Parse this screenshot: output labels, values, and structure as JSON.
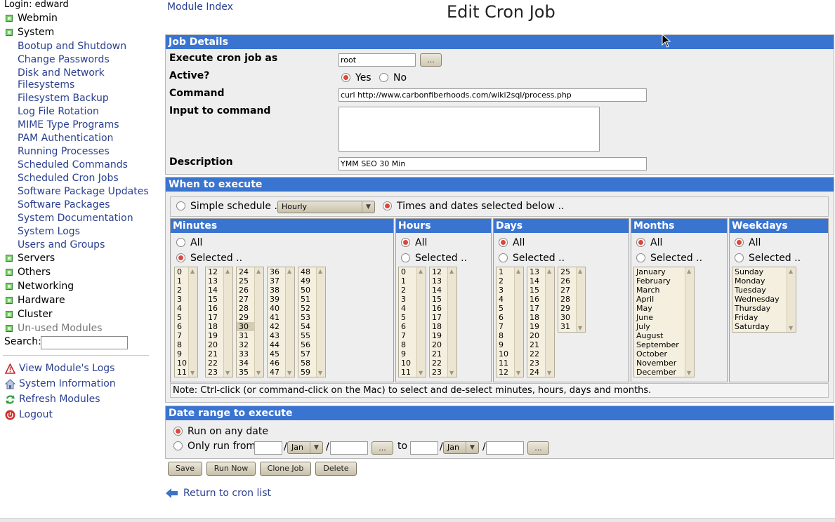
{
  "left": {
    "login": "Login: edward",
    "categories": {
      "webmin": "Webmin",
      "system": "System",
      "servers": "Servers",
      "others": "Others",
      "networking": "Networking",
      "hardware": "Hardware",
      "cluster": "Cluster",
      "unused": "Un-used Modules"
    },
    "system_items": [
      "Bootup and Shutdown",
      "Change Passwords",
      "Disk and Network",
      "Filesystems",
      "Filesystem Backup",
      "Log File Rotation",
      "MIME Type Programs",
      "PAM Authentication",
      "Running Processes",
      "Scheduled Commands",
      "Scheduled Cron Jobs",
      "Software Package Updates",
      "Software Packages",
      "System Documentation",
      "System Logs",
      "Users and Groups"
    ],
    "search_label": "Search:",
    "actions": {
      "view_logs": "View Module's Logs",
      "system_info": "System Information",
      "refresh": "Refresh Modules",
      "logout": "Logout"
    }
  },
  "header": {
    "module_index": "Module Index",
    "title": "Edit Cron Job"
  },
  "job_details": {
    "header": "Job Details",
    "execute_as_label": "Execute cron job as",
    "execute_as_value": "root",
    "user_picker_button": "...",
    "active_label": "Active?",
    "active_yes": "Yes",
    "active_no": "No",
    "command_label": "Command",
    "command_value": "curl http://www.carbonfiberhoods.com/wiki2sql/process.php",
    "input_label": "Input to command",
    "description_label": "Description",
    "description_value": "YMM SEO 30 Min"
  },
  "when": {
    "header": "When to execute",
    "simple_label": "Simple schedule ..",
    "simple_value": "Hourly",
    "selected_label": "Times and dates selected below ..",
    "all_label": "All",
    "selected_option_label": "Selected ..",
    "minutes_header": "Minutes",
    "hours_header": "Hours",
    "days_header": "Days",
    "months_header": "Months",
    "weekdays_header": "Weekdays",
    "minutes_cols": [
      [
        "0",
        "1",
        "2",
        "3",
        "4",
        "5",
        "6",
        "7",
        "8",
        "9",
        "10",
        "11"
      ],
      [
        "12",
        "13",
        "14",
        "15",
        "16",
        "17",
        "18",
        "19",
        "20",
        "21",
        "22",
        "23"
      ],
      [
        "24",
        "25",
        "26",
        "27",
        "28",
        "29",
        "30",
        "31",
        "32",
        "33",
        "34",
        "35"
      ],
      [
        "36",
        "37",
        "38",
        "39",
        "40",
        "41",
        "42",
        "43",
        "44",
        "45",
        "46",
        "47"
      ],
      [
        "48",
        "49",
        "50",
        "51",
        "52",
        "53",
        "54",
        "55",
        "56",
        "57",
        "58",
        "59"
      ]
    ],
    "minutes_selected": "30",
    "hours_cols": [
      [
        "0",
        "1",
        "2",
        "3",
        "4",
        "5",
        "6",
        "7",
        "8",
        "9",
        "10",
        "11"
      ],
      [
        "12",
        "13",
        "14",
        "15",
        "16",
        "17",
        "18",
        "19",
        "20",
        "21",
        "22",
        "23"
      ]
    ],
    "days_cols": [
      [
        "1",
        "2",
        "3",
        "4",
        "5",
        "6",
        "7",
        "8",
        "9",
        "10",
        "11",
        "12"
      ],
      [
        "13",
        "14",
        "15",
        "16",
        "17",
        "18",
        "19",
        "20",
        "21",
        "22",
        "23",
        "24"
      ],
      [
        "25",
        "26",
        "27",
        "28",
        "29",
        "30",
        "31"
      ]
    ],
    "months": [
      "January",
      "February",
      "March",
      "April",
      "May",
      "June",
      "July",
      "August",
      "September",
      "October",
      "November",
      "December"
    ],
    "weekdays": [
      "Sunday",
      "Monday",
      "Tuesday",
      "Wednesday",
      "Thursday",
      "Friday",
      "Saturday"
    ],
    "note": "Note: Ctrl-click (or command-click on the Mac) to select and de-select minutes, hours, days and months."
  },
  "date_range": {
    "header": "Date range to execute",
    "any_date": "Run on any date",
    "only_from": "Only run from",
    "month_from": "Jan",
    "month_to": "Jan",
    "to_label": "to",
    "picker_button": "...",
    "slash": "/"
  },
  "buttons": {
    "save": "Save",
    "run_now": "Run Now",
    "clone": "Clone Job",
    "delete": "Delete"
  },
  "return_link": "Return to cron list"
}
